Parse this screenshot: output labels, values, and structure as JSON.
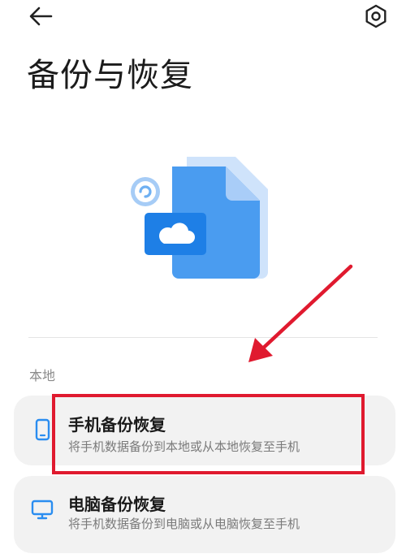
{
  "header": {
    "back_icon": "arrow-left-icon",
    "settings_icon": "hexagon-gear-icon",
    "title": "备份与恢复"
  },
  "hero": {
    "illustration": "cloud-file-backup-illustration"
  },
  "sections": [
    {
      "label": "本地",
      "items": [
        {
          "icon": "phone-icon",
          "title": "手机备份恢复",
          "description": "将手机数据备份到本地或从本地恢复至手机"
        },
        {
          "icon": "computer-monitor-icon",
          "title": "电脑备份恢复",
          "description": "将手机数据备份到电脑或从电脑恢复至手机"
        }
      ]
    }
  ],
  "annotations": {
    "highlight_color": "#e01a2f"
  },
  "colors": {
    "accent_blue": "#2a8df0",
    "card_bg": "#f2f2f2"
  }
}
